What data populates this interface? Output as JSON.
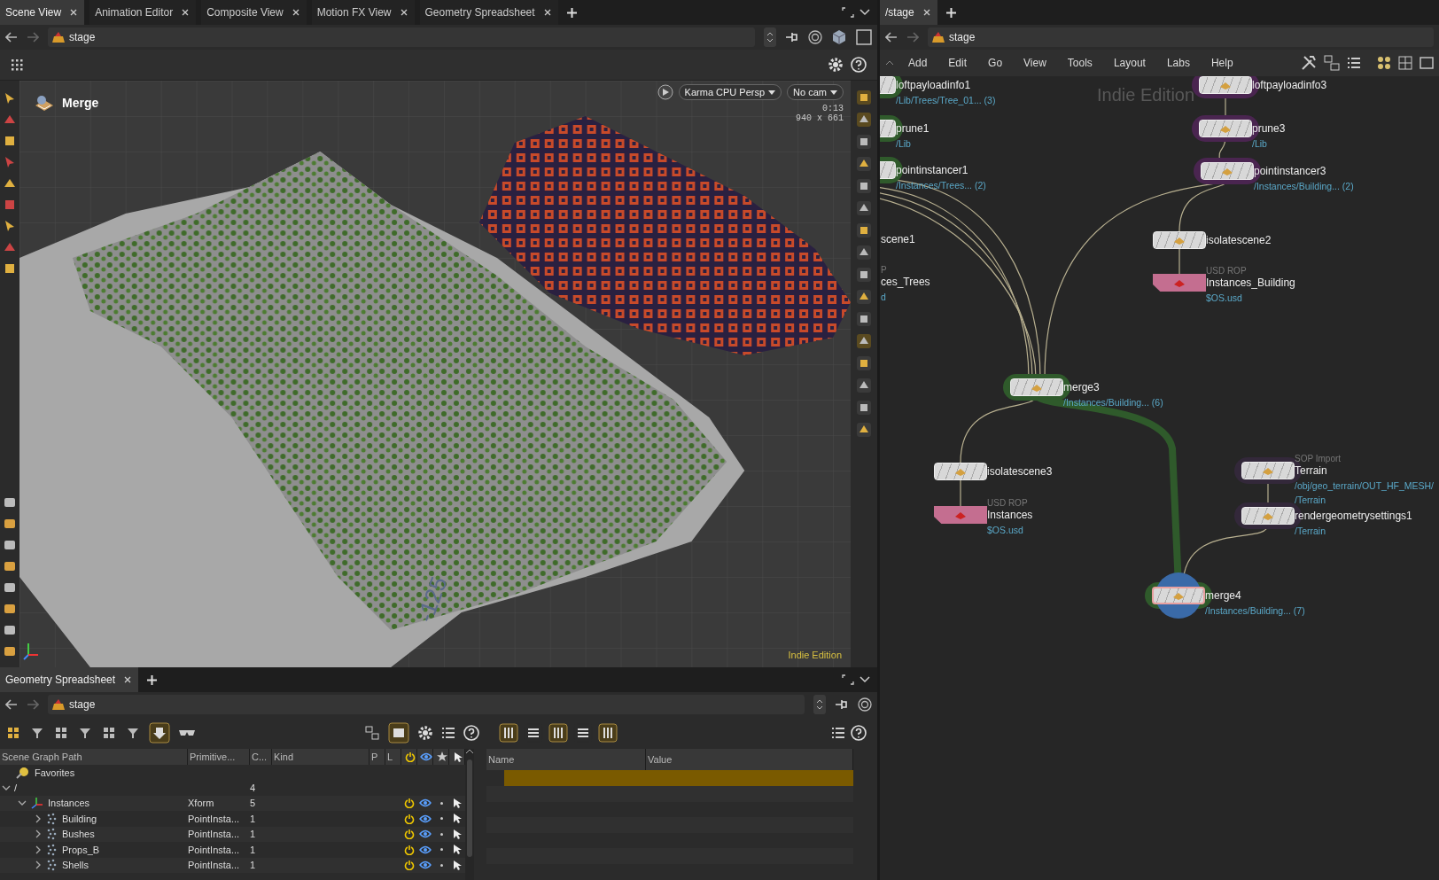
{
  "scene_tabs": [
    {
      "label": "Scene View",
      "selected": true
    },
    {
      "label": "Animation Editor",
      "selected": false
    },
    {
      "label": "Composite View",
      "selected": false
    },
    {
      "label": "Motion FX View",
      "selected": false
    },
    {
      "label": "Geometry Spreadsheet",
      "selected": false
    }
  ],
  "scene_path": "stage",
  "viewport": {
    "node_name": "Merge",
    "renderer": "Karma CPU  Persp",
    "camera": "No cam",
    "time": "0:13",
    "resolution": "940 x 661",
    "edition": "Indie Edition",
    "grid_label": "-125"
  },
  "spreadsheet": {
    "tabs": [
      {
        "label": "Geometry Spreadsheet",
        "selected": true
      }
    ],
    "path": "stage",
    "columns": [
      "Scene Graph Path",
      "Primitive...",
      "C...",
      "Kind",
      "P",
      "L"
    ],
    "favorites": "Favorites",
    "tree": [
      {
        "name": "/",
        "count": "4",
        "expanded": true,
        "children": [
          {
            "name": "Instances",
            "kind": "xform",
            "type": "Xform",
            "count": "5",
            "expanded": true,
            "active": true,
            "visible": true,
            "children": [
              {
                "name": "Building",
                "kind": "instancer",
                "type": "PointInsta...",
                "count": "1",
                "expanded": false,
                "active": true,
                "visible": true
              },
              {
                "name": "Bushes",
                "kind": "instancer",
                "type": "PointInsta...",
                "count": "1",
                "expanded": false,
                "active": true,
                "visible": true
              },
              {
                "name": "Props_B",
                "kind": "instancer",
                "type": "PointInsta...",
                "count": "1",
                "expanded": false,
                "active": true,
                "visible": true
              },
              {
                "name": "Shells",
                "kind": "instancer",
                "type": "PointInsta...",
                "count": "1",
                "expanded": false,
                "active": true,
                "visible": true
              }
            ]
          }
        ]
      }
    ],
    "attr_columns": [
      "Name",
      "Value"
    ]
  },
  "network": {
    "tabs": [
      {
        "label": "/stage",
        "selected": true
      }
    ],
    "path": "stage",
    "menu": [
      "Add",
      "Edit",
      "Go",
      "View",
      "Tools",
      "Layout",
      "Labs",
      "Help"
    ],
    "watermark": "Indie Edition",
    "nodes": [
      {
        "name": "loftpayloadinfo1",
        "kind": "lop",
        "color": "#2f5a2b",
        "subtitles": [
          "/Lib/Trees/Tree_01... (3)"
        ],
        "selected": false
      },
      {
        "name": "prune1",
        "kind": "lop",
        "color": "#2f5a2b",
        "subtitles": [
          "/Lib"
        ],
        "selected": false
      },
      {
        "name": "pointinstancer1",
        "kind": "lop",
        "color": "#2f5a2b",
        "subtitles": [
          "/Instances/Trees... (2)"
        ],
        "selected": false
      },
      {
        "name": "scene1",
        "kind": "offscreen",
        "selected": false
      },
      {
        "name": "ces_Trees",
        "kind": "offscreen",
        "type": "P",
        "subtitles": [
          "d"
        ],
        "selected": false
      },
      {
        "name": "loftpayloadinfo3",
        "kind": "lop",
        "color": "#4a2550",
        "selected": false
      },
      {
        "name": "prune3",
        "kind": "lop",
        "color": "#4a2550",
        "subtitles": [
          "/Lib"
        ],
        "selected": false
      },
      {
        "name": "pointinstancer3",
        "kind": "lop",
        "color": "#4a2550",
        "subtitles": [
          "/Instances/Building... (2)"
        ],
        "selected": false
      },
      {
        "name": "isolatescene2",
        "kind": "lop",
        "selected": false
      },
      {
        "name": "Instances_Building",
        "kind": "rop",
        "type": "USD ROP",
        "subtitles": [
          "$OS.usd"
        ],
        "selected": false
      },
      {
        "name": "merge3",
        "kind": "lop",
        "color": "#2f5a2b",
        "subtitles": [
          "/Instances/Building... (6)"
        ],
        "selected": false
      },
      {
        "name": "isolatescene3",
        "kind": "lop",
        "selected": false
      },
      {
        "name": "Instances",
        "kind": "rop",
        "type": "USD ROP",
        "subtitles": [
          "$OS.usd"
        ],
        "selected": false
      },
      {
        "name": "Terrain",
        "kind": "lop",
        "color": "#33283a",
        "type": "SOP Import",
        "subtitles": [
          "/obj/geo_terrain/OUT_HF_MESH/",
          "/Terrain"
        ],
        "selected": false
      },
      {
        "name": "rendergeometrysettings1",
        "kind": "lop",
        "color": "#33283a",
        "subtitles": [
          "/Terrain"
        ],
        "selected": false
      },
      {
        "name": "merge4",
        "kind": "lop",
        "color": "#2f5a2b",
        "subtitles": [
          "/Instances/Building... (7)"
        ],
        "selected": true
      }
    ]
  }
}
